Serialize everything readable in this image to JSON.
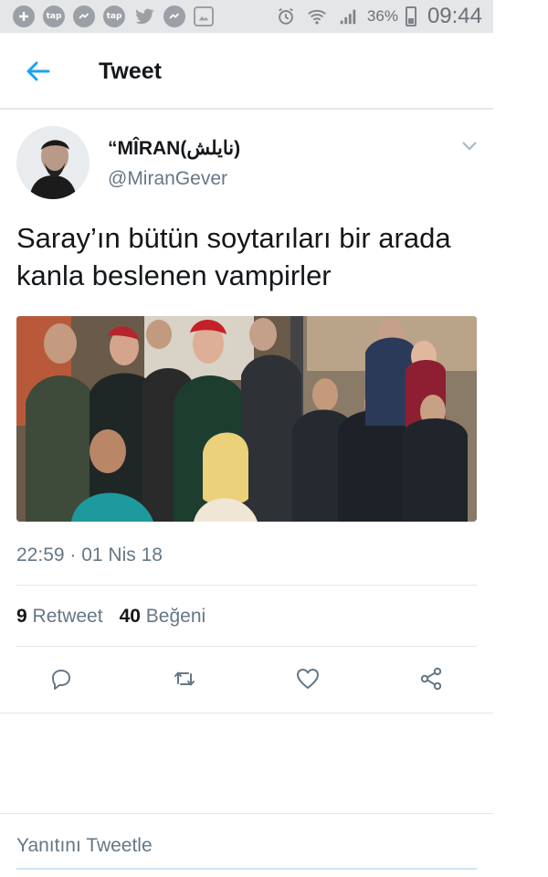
{
  "status_bar": {
    "left_icons": [
      "plus-icon",
      "tap-icon",
      "messenger-icon",
      "tap-icon",
      "twitter-icon",
      "messenger-icon",
      "gallery-icon"
    ],
    "left_icon_text": "tap",
    "battery_percent": "36%",
    "battery_level": 0.36,
    "time": "09:44"
  },
  "header": {
    "title": "Tweet"
  },
  "tweet": {
    "author_name": "“MÎRAN(نايلش)",
    "author_handle": "@MiranGever",
    "text": "Saray’ın bütün soytarıları bir arada kanla beslenen vampirler",
    "timestamp": "22:59 · 01 Nis 18",
    "retweet_count": "9",
    "retweet_label": "Retweet",
    "like_count": "40",
    "like_label": "Beğeni"
  },
  "actions": [
    "reply-icon",
    "retweet-icon",
    "like-icon",
    "share-icon"
  ],
  "reply_box": {
    "placeholder": "Yanıtını Tweetle"
  },
  "colors": {
    "accent": "#1da1f2",
    "secondary_text": "#657786",
    "status_bar_bg": "#e4e6e8"
  }
}
